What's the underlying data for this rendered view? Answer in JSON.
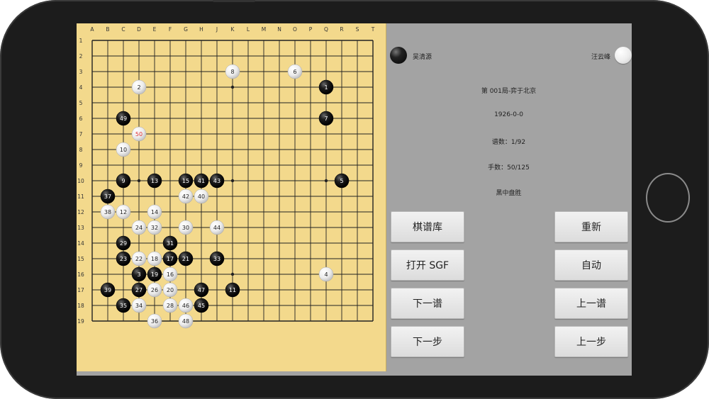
{
  "players": {
    "black": {
      "name": "吴清源",
      "stone_color": "#111111"
    },
    "white": {
      "name": "汪云峰",
      "stone_color": "#f4f4f4"
    }
  },
  "game_info": {
    "title": "第 001局-弈于北京",
    "date": "1926-0-0",
    "record_count": "谱数：1/92",
    "move_count": "手数：50/125",
    "result": "黑中盘胜"
  },
  "buttons": {
    "library": "棋谱库",
    "open_sgf": "打开 SGF",
    "next_record": "下一谱",
    "next_move": "下一步",
    "reset": "重新",
    "auto": "自动",
    "prev_record": "上一谱",
    "prev_move": "上一步"
  },
  "board": {
    "size": 19,
    "column_labels": [
      "A",
      "B",
      "C",
      "D",
      "E",
      "F",
      "G",
      "H",
      "J",
      "K",
      "L",
      "M",
      "N",
      "O",
      "P",
      "Q",
      "R",
      "S",
      "T"
    ],
    "row_labels": [
      "1",
      "2",
      "3",
      "4",
      "5",
      "6",
      "7",
      "8",
      "9",
      "10",
      "11",
      "12",
      "13",
      "14",
      "15",
      "16",
      "17",
      "18",
      "19"
    ],
    "last_move_color": "#e03030",
    "background_color": "#f3d98c",
    "stones": [
      {
        "col": "Q",
        "row": 4,
        "color": "black",
        "num": "1"
      },
      {
        "col": "D",
        "row": 4,
        "color": "white",
        "num": "2"
      },
      {
        "col": "D",
        "row": 16,
        "color": "black",
        "num": "3"
      },
      {
        "col": "Q",
        "row": 16,
        "color": "white",
        "num": "4"
      },
      {
        "col": "R",
        "row": 10,
        "color": "black",
        "num": "5"
      },
      {
        "col": "O",
        "row": 3,
        "color": "white",
        "num": "6"
      },
      {
        "col": "Q",
        "row": 6,
        "color": "black",
        "num": "7"
      },
      {
        "col": "K",
        "row": 3,
        "color": "white",
        "num": "8"
      },
      {
        "col": "C",
        "row": 10,
        "color": "black",
        "num": "9"
      },
      {
        "col": "C",
        "row": 8,
        "color": "white",
        "num": "10"
      },
      {
        "col": "K",
        "row": 17,
        "color": "black",
        "num": "11"
      },
      {
        "col": "C",
        "row": 12,
        "color": "white",
        "num": "12"
      },
      {
        "col": "E",
        "row": 10,
        "color": "black",
        "num": "13"
      },
      {
        "col": "E",
        "row": 12,
        "color": "white",
        "num": "14"
      },
      {
        "col": "G",
        "row": 10,
        "color": "black",
        "num": "15"
      },
      {
        "col": "F",
        "row": 16,
        "color": "white",
        "num": "16"
      },
      {
        "col": "F",
        "row": 15,
        "color": "black",
        "num": "17"
      },
      {
        "col": "E",
        "row": 15,
        "color": "white",
        "num": "18"
      },
      {
        "col": "E",
        "row": 16,
        "color": "black",
        "num": "19"
      },
      {
        "col": "F",
        "row": 17,
        "color": "white",
        "num": "20"
      },
      {
        "col": "G",
        "row": 15,
        "color": "black",
        "num": "21"
      },
      {
        "col": "D",
        "row": 15,
        "color": "white",
        "num": "22"
      },
      {
        "col": "C",
        "row": 15,
        "color": "black",
        "num": "23"
      },
      {
        "col": "D",
        "row": 13,
        "color": "white",
        "num": "24"
      },
      {
        "col": "E",
        "row": 17,
        "color": "white",
        "num": "26"
      },
      {
        "col": "D",
        "row": 17,
        "color": "black",
        "num": "27"
      },
      {
        "col": "F",
        "row": 18,
        "color": "white",
        "num": "28"
      },
      {
        "col": "C",
        "row": 14,
        "color": "black",
        "num": "29"
      },
      {
        "col": "G",
        "row": 13,
        "color": "white",
        "num": "30"
      },
      {
        "col": "F",
        "row": 14,
        "color": "black",
        "num": "31"
      },
      {
        "col": "E",
        "row": 13,
        "color": "white",
        "num": "32"
      },
      {
        "col": "J",
        "row": 15,
        "color": "black",
        "num": "33"
      },
      {
        "col": "D",
        "row": 18,
        "color": "white",
        "num": "34"
      },
      {
        "col": "C",
        "row": 18,
        "color": "black",
        "num": "35"
      },
      {
        "col": "E",
        "row": 19,
        "color": "white",
        "num": "36"
      },
      {
        "col": "B",
        "row": 11,
        "color": "black",
        "num": "37"
      },
      {
        "col": "B",
        "row": 12,
        "color": "white",
        "num": "38"
      },
      {
        "col": "B",
        "row": 17,
        "color": "black",
        "num": "39"
      },
      {
        "col": "H",
        "row": 11,
        "color": "white",
        "num": "40"
      },
      {
        "col": "H",
        "row": 10,
        "color": "black",
        "num": "41"
      },
      {
        "col": "G",
        "row": 11,
        "color": "white",
        "num": "42"
      },
      {
        "col": "J",
        "row": 10,
        "color": "black",
        "num": "43"
      },
      {
        "col": "J",
        "row": 13,
        "color": "white",
        "num": "44"
      },
      {
        "col": "H",
        "row": 18,
        "color": "black",
        "num": "45"
      },
      {
        "col": "G",
        "row": 18,
        "color": "white",
        "num": "46"
      },
      {
        "col": "H",
        "row": 17,
        "color": "black",
        "num": "47"
      },
      {
        "col": "G",
        "row": 19,
        "color": "white",
        "num": "48"
      },
      {
        "col": "C",
        "row": 6,
        "color": "black",
        "num": "49"
      },
      {
        "col": "D",
        "row": 7,
        "color": "white",
        "num": "50",
        "last": true
      }
    ]
  }
}
